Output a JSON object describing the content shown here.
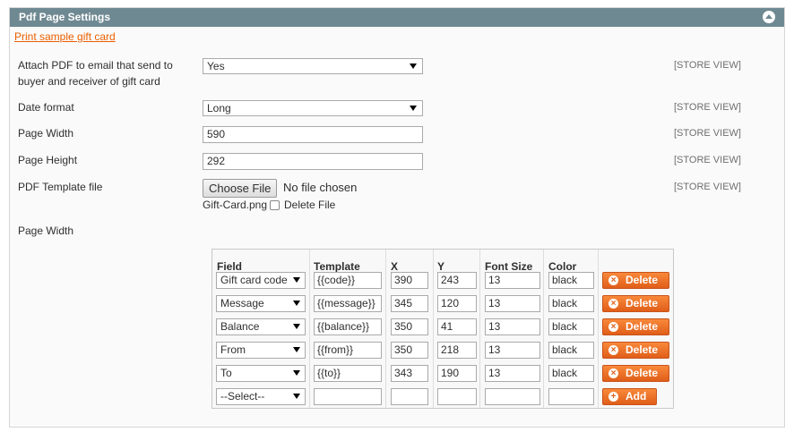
{
  "panel": {
    "title": "Pdf Page Settings"
  },
  "print_link": "Print sample gift card",
  "fields": {
    "attach": {
      "label_line1": "Attach PDF to email that send to",
      "label_line2": "buyer and receiver of gift card",
      "value": "Yes",
      "scope": "[STORE VIEW]"
    },
    "date_format": {
      "label": "Date format",
      "value": "Long",
      "scope": "[STORE VIEW]"
    },
    "page_width": {
      "label": "Page Width",
      "value": "590",
      "scope": "[STORE VIEW]"
    },
    "page_height": {
      "label": "Page Height",
      "value": "292",
      "scope": "[STORE VIEW]"
    },
    "template_file": {
      "label": "PDF Template file",
      "button": "Choose File",
      "no_file": "No file chosen",
      "current_file": "Gift-Card.png",
      "delete_label": "Delete File",
      "scope": "[STORE VIEW]"
    }
  },
  "page_width_section": {
    "label": "Page Width"
  },
  "grid": {
    "headers": {
      "field": "Field",
      "template": "Template",
      "x": "X",
      "y": "Y",
      "font_size": "Font Size",
      "color": "Color"
    },
    "rows": [
      {
        "field": "Gift card code",
        "template": "{{code}}",
        "x": "390",
        "y": "243",
        "font_size": "13",
        "color": "black",
        "action": "Delete"
      },
      {
        "field": "Message",
        "template": "{{message}}",
        "x": "345",
        "y": "120",
        "font_size": "13",
        "color": "black",
        "action": "Delete"
      },
      {
        "field": "Balance",
        "template": "{{balance}}",
        "x": "350",
        "y": "41",
        "font_size": "13",
        "color": "black",
        "action": "Delete"
      },
      {
        "field": "From",
        "template": "{{from}}",
        "x": "350",
        "y": "218",
        "font_size": "13",
        "color": "black",
        "action": "Delete"
      },
      {
        "field": "To",
        "template": "{{to}}",
        "x": "343",
        "y": "190",
        "font_size": "13",
        "color": "black",
        "action": "Delete"
      }
    ],
    "new_row": {
      "field": "--Select--",
      "action": "Add"
    }
  },
  "colors": {
    "header_bg": "#6f8992",
    "link": "#eb5e00",
    "button": "#f07a2c"
  }
}
